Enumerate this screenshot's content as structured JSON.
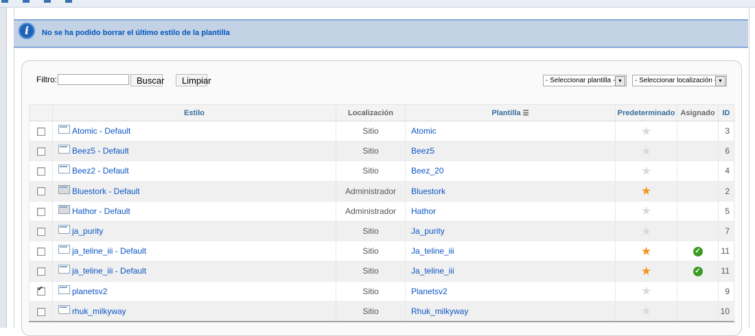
{
  "message": {
    "text": "No se ha podido borrar el último estilo de la plantilla"
  },
  "filter": {
    "label": "Filtro:",
    "value": "",
    "search_label": "Buscar",
    "clear_label": "Limpiar",
    "template_select": "- Seleccionar plantilla -",
    "location_select": "- Seleccionar localización -"
  },
  "table": {
    "headers": {
      "style": "Estilo",
      "location": "Localización",
      "template": "Plantilla",
      "default": "Predeterminado",
      "assigned": "Asignado",
      "id": "ID"
    },
    "rows": [
      {
        "checked": false,
        "style": "Atomic - Default",
        "location": "Sitio",
        "template": "Atomic",
        "default": false,
        "assigned": false,
        "id": "3"
      },
      {
        "checked": false,
        "style": "Beez5 - Default",
        "location": "Sitio",
        "template": "Beez5",
        "default": false,
        "assigned": false,
        "id": "6"
      },
      {
        "checked": false,
        "style": "Beez2 - Default",
        "location": "Sitio",
        "template": "Beez_20",
        "default": false,
        "assigned": false,
        "id": "4"
      },
      {
        "checked": false,
        "style": "Bluestork - Default",
        "location": "Administrador",
        "template": "Bluestork",
        "default": true,
        "assigned": false,
        "id": "2"
      },
      {
        "checked": false,
        "style": "Hathor - Default",
        "location": "Administrador",
        "template": "Hathor",
        "default": false,
        "assigned": false,
        "id": "5"
      },
      {
        "checked": false,
        "style": "ja_purity",
        "location": "Sitio",
        "template": "Ja_purity",
        "default": false,
        "assigned": false,
        "id": "7"
      },
      {
        "checked": false,
        "style": "ja_teline_iii - Default",
        "location": "Sitio",
        "template": "Ja_teline_iii",
        "default": true,
        "assigned": true,
        "id": "11"
      },
      {
        "checked": false,
        "style": "ja_teline_iii - Default",
        "location": "Sitio",
        "template": "Ja_teline_iii",
        "default": true,
        "assigned": true,
        "id": "11"
      },
      {
        "checked": true,
        "style": "planetsv2",
        "location": "Sitio",
        "template": "Planetsv2",
        "default": false,
        "assigned": false,
        "id": "9"
      },
      {
        "checked": false,
        "style": "rhuk_milkyway",
        "location": "Sitio",
        "template": "Rhuk_milkyway",
        "default": false,
        "assigned": false,
        "id": "10"
      }
    ]
  },
  "icons": {
    "info": "info-icon",
    "star": "star-icon",
    "check": "check-icon",
    "template": "template-icon",
    "sort": "sort-icon"
  },
  "colors": {
    "link": "#0b55c4",
    "message_text": "#0055bb",
    "message_bg": "#c3d2e5",
    "star_on": "#f39421",
    "assigned": "#3a9a23"
  }
}
